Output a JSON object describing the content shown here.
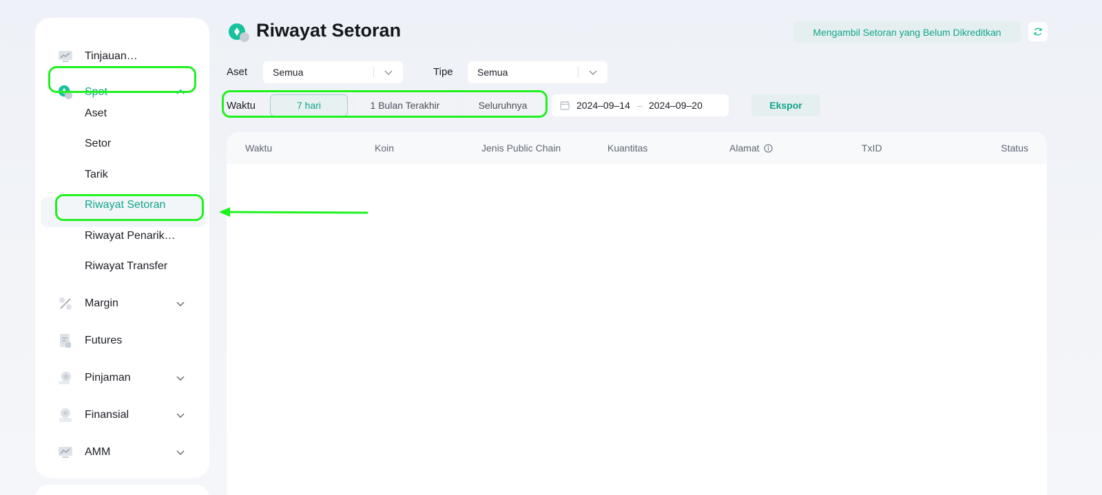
{
  "sidebar": {
    "items": [
      {
        "label": "Tinjauan…",
        "icon": "overview-icon"
      },
      {
        "label": "Spot",
        "icon": "spot-icon",
        "expanded": true
      },
      {
        "label": "Margin",
        "icon": "margin-icon"
      },
      {
        "label": "Futures",
        "icon": "futures-icon"
      },
      {
        "label": "Pinjaman",
        "icon": "loan-icon"
      },
      {
        "label": "Finansial",
        "icon": "finance-icon"
      },
      {
        "label": "AMM",
        "icon": "amm-icon"
      }
    ],
    "spot_sub": [
      "Aset",
      "Setor",
      "Tarik",
      "Riwayat Setoran",
      "Riwayat Penarik…",
      "Riwayat Transfer"
    ],
    "active_sub": "Riwayat Setoran"
  },
  "header": {
    "title": "Riwayat Setoran",
    "pending_button": "Mengambil Setoran yang Belum Dikreditkan"
  },
  "filters": {
    "asset_label": "Aset",
    "asset_value": "Semua",
    "type_label": "Tipe",
    "type_value": "Semua",
    "time_label": "Waktu",
    "time_options": [
      "7 hari",
      "1 Bulan Terakhir",
      "Seluruhnya"
    ],
    "time_selected": "7 hari",
    "date_start": "2024–09–14",
    "date_sep": "–",
    "date_end": "2024–09–20",
    "export_label": "Ekspor"
  },
  "table": {
    "columns": [
      "Waktu",
      "Koin",
      "Jenis Public Chain",
      "Kuantitas",
      "Alamat",
      "TxID",
      "Status"
    ],
    "rows": []
  },
  "colors": {
    "accent": "#0ea58a",
    "highlight": "#1df21d"
  }
}
